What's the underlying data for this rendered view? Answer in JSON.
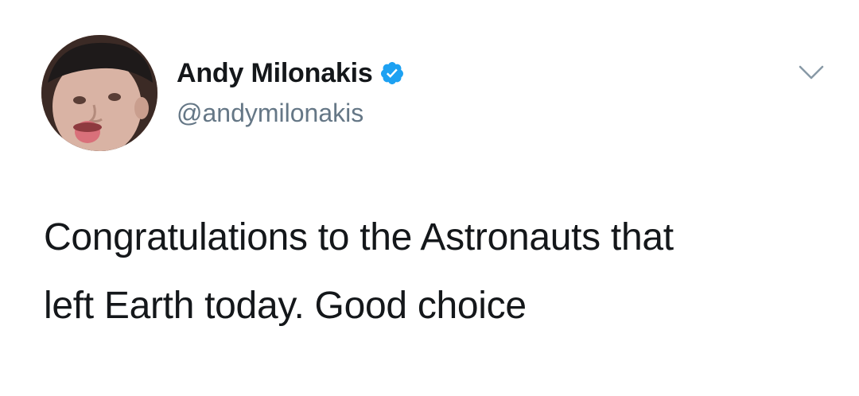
{
  "tweet": {
    "author": {
      "display_name": "Andy Milonakis",
      "handle": "@andymilonakis",
      "verified": true
    },
    "text_lines": [
      "Congratulations to the Astronauts that",
      "left Earth today. Good choice"
    ],
    "icons": {
      "verified": "verified-badge-icon",
      "menu": "chevron-down-icon"
    },
    "colors": {
      "verified_blue": "#1da1f2",
      "text": "#14171a",
      "handle_gray": "#657786"
    }
  }
}
